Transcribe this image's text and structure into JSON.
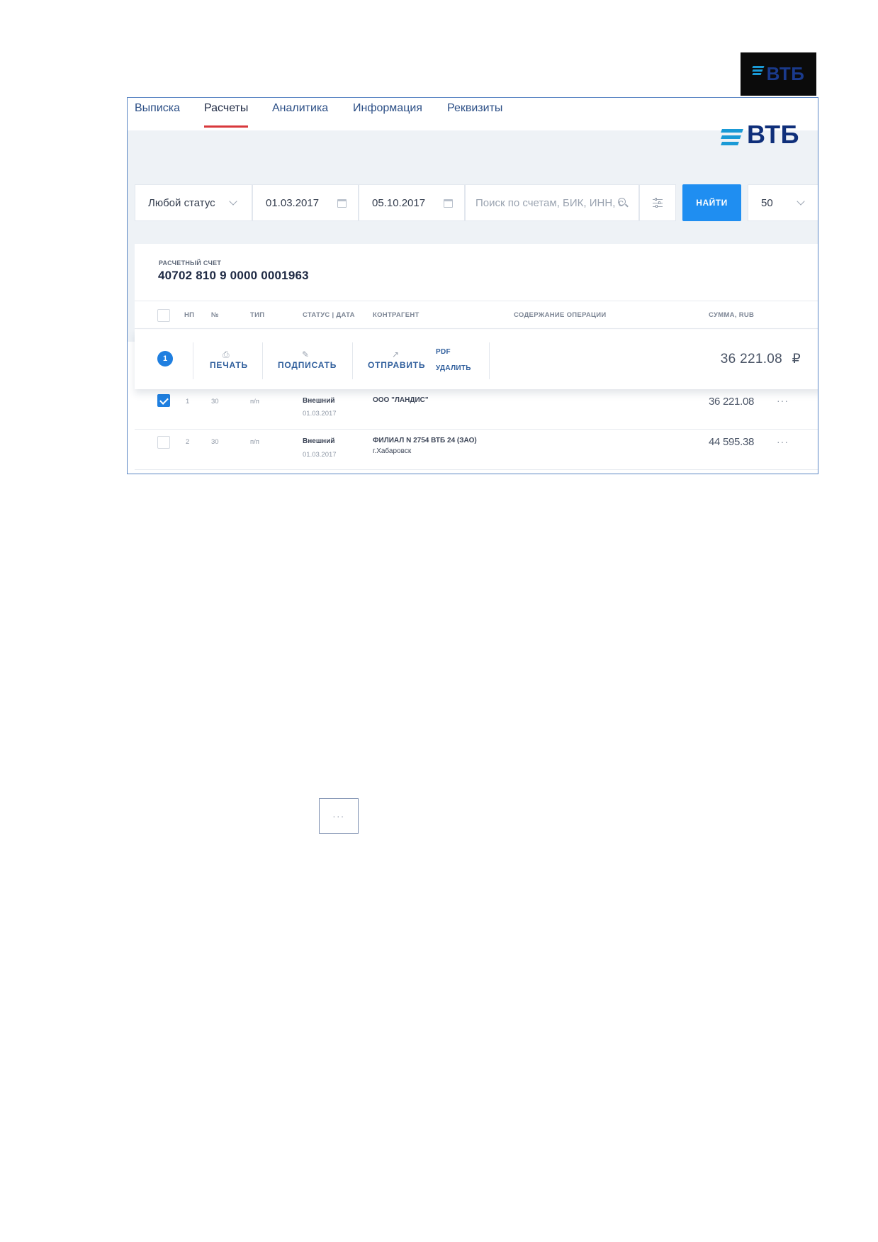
{
  "brand": {
    "corner_logo_text": "ВТБ",
    "header_logo_text": "ВТБ",
    "colors": {
      "stripes": "#1a9ad6",
      "wordmark": "#0f2f7a",
      "accent_red": "#d8383c",
      "primary_blue": "#1f8ef1"
    }
  },
  "nav": {
    "tabs": [
      {
        "label": "Выписка",
        "active": false
      },
      {
        "label": "Расчеты",
        "active": true
      },
      {
        "label": "Аналитика",
        "active": false
      },
      {
        "label": "Информация",
        "active": false
      },
      {
        "label": "Реквизиты",
        "active": false
      }
    ]
  },
  "filters": {
    "status_value": "Любой статус",
    "date_from": "01.03.2017",
    "date_to": "05.10.2017",
    "search_placeholder": "Поиск по счетам, БИК, ИНН, с",
    "find_button": "НАЙТИ",
    "page_size": "50"
  },
  "account": {
    "label": "РАСЧЕТНЫЙ СЧЕТ",
    "number": "40702 810 9 0000 0001963"
  },
  "table": {
    "columns": [
      "НП",
      "№",
      "ТИП",
      "СТАТУС | ДАТА",
      "КОНТРАГЕНТ",
      "СОДЕРЖАНИЕ ОПЕРАЦИИ",
      "СУММА, RUB"
    ],
    "rows": [
      {
        "np": "1",
        "num": "30",
        "type": "п/п",
        "status": "Внешний",
        "date": "01.03.2017",
        "counterparty": "ООО \"ЛАНДИС\"",
        "counterparty_2": "",
        "amount": "36 221.08",
        "checked": true
      },
      {
        "np": "2",
        "num": "30",
        "type": "п/п",
        "status": "Внешний",
        "date": "01.03.2017",
        "counterparty": "ФИЛИАЛ N 2754 ВТБ 24 (ЗАО)",
        "counterparty_2": "г.Хабаровск",
        "amount": "44 595.38",
        "checked": false
      }
    ],
    "row_menu": "···"
  },
  "actions": {
    "selected_count": "1",
    "print": "ПЕЧАТЬ",
    "sign": "ПОДПИСАТЬ",
    "send": "ОТПРАВИТЬ",
    "pdf": "PDF",
    "delete": "УДАЛИТЬ",
    "total": "36 221.08",
    "currency_sign": "₽"
  },
  "more_widget": {
    "label": "···"
  }
}
